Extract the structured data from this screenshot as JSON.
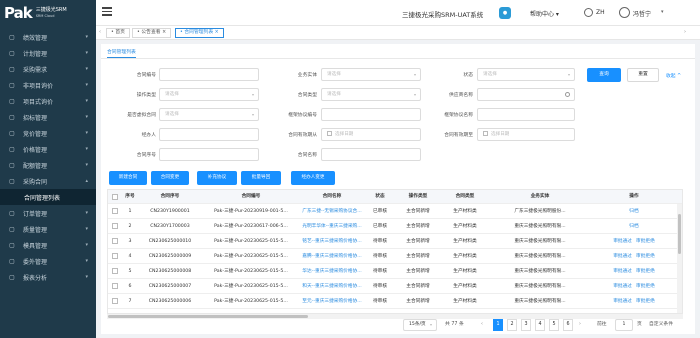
{
  "brand": {
    "logo": "Pak",
    "title": "三捷极光SRM",
    "subtitle": "SRM Cloud"
  },
  "sidebar": {
    "items": [
      {
        "label": "绩效管理",
        "icon": "chart-icon"
      },
      {
        "label": "计划管理",
        "icon": "calendar-icon"
      },
      {
        "label": "采购需求",
        "icon": "cart-icon"
      },
      {
        "label": "非项目询价",
        "icon": "doc-icon"
      },
      {
        "label": "项目式询价",
        "icon": "folder-icon"
      },
      {
        "label": "招标管理",
        "icon": "gavel-icon"
      },
      {
        "label": "竞价管理",
        "icon": "hammer-icon"
      },
      {
        "label": "价格管理",
        "icon": "tag-icon"
      },
      {
        "label": "配额管理",
        "icon": "pie-icon"
      },
      {
        "label": "采购合同",
        "icon": "contract-icon",
        "expanded": true
      }
    ],
    "submenu": "合同管理列表",
    "items_after": [
      {
        "label": "订单管理",
        "icon": "order-icon"
      },
      {
        "label": "质量管理",
        "icon": "quality-icon"
      },
      {
        "label": "模具管理",
        "icon": "mold-icon"
      },
      {
        "label": "委外管理",
        "icon": "outsource-icon"
      },
      {
        "label": "报表分析",
        "icon": "report-icon"
      }
    ]
  },
  "header": {
    "title": "三捷极光采购SRM-UAT系统",
    "help": "帮助中心",
    "lang": "ZH",
    "user": "冯哲宁"
  },
  "tabs": [
    "首页",
    "公告查看",
    "合同管理列表"
  ],
  "subtab": "合同管理列表",
  "filters": {
    "col1": [
      "合同编号",
      "操作类型",
      "是否虚拟合同",
      "经办人",
      "合同序号"
    ],
    "col2": [
      "业务实体",
      "合同类型",
      "框架协议编号",
      "合同有效期从",
      "合同名称"
    ],
    "col3": [
      "状态",
      "供应商名称",
      "框架协议名称",
      "合同有效期至"
    ],
    "select_ph": "请选择",
    "date_ph": "选择日期"
  },
  "buttons": {
    "search": "查询",
    "reset": "重置",
    "collapse": "收起 ^"
  },
  "actions": [
    "新建合同",
    "合同变更",
    "补充协议",
    "批量导回",
    "经办人变更"
  ],
  "grid": {
    "headers": [
      "",
      "序号",
      "合同序号",
      "合同编号",
      "合同名称",
      "状态",
      "操作类型",
      "合同类型",
      "业务实体",
      "操作"
    ],
    "rows": [
      {
        "no": "1",
        "seq": "CN230Y1900001",
        "code": "Pak-三捷-Pur-20230919-001-5...",
        "name": "广东三捷--无锡采购协议合...",
        "status": "已审核",
        "op": "主合同新增",
        "type": "生产材料类",
        "entity": "广东三捷极光照明股份...",
        "actions": [
          "归档"
        ]
      },
      {
        "no": "2",
        "seq": "CN230Y1700003",
        "code": "Pak-三捷-Pur-20230617-006-5...",
        "name": "光明丰华体--重庆三捷采购...",
        "status": "已审核",
        "op": "主合同新增",
        "type": "生产材料类",
        "entity": "重庆三捷极光照明有限...",
        "actions": [
          "归档"
        ]
      },
      {
        "no": "3",
        "seq": "CN230625000010",
        "code": "Pak-三捷-Pur-20230625-015-5...",
        "name": "铭艺--重庆三捷采购价格协...",
        "status": "待审核",
        "op": "主合同新增",
        "type": "生产材料类",
        "entity": "重庆三捷极光照明有限...",
        "actions": [
          "审批通过",
          "审批拒绝"
        ]
      },
      {
        "no": "4",
        "seq": "CN230625000009",
        "code": "Pak-三捷-Pur-20230625-015-5...",
        "name": "嘉腾--重庆三捷采购价格协...",
        "status": "待审核",
        "op": "主合同新增",
        "type": "生产材料类",
        "entity": "重庆三捷极光照明有限...",
        "actions": [
          "审批通过",
          "审批拒绝"
        ]
      },
      {
        "no": "5",
        "seq": "CN230625000008",
        "code": "Pak-三捷-Pur-20230625-015-5...",
        "name": "华达--重庆三捷采购价格协...",
        "status": "待审核",
        "op": "主合同新增",
        "type": "生产材料类",
        "entity": "重庆三捷极光照明有限...",
        "actions": [
          "审批通过",
          "审批拒绝"
        ]
      },
      {
        "no": "6",
        "seq": "CN230625000007",
        "code": "Pak-三捷-Pur-20230625-015-5...",
        "name": "和天--重庆三捷采购价格协...",
        "status": "待审核",
        "op": "主合同新增",
        "type": "生产材料类",
        "entity": "重庆三捷极光照明有限...",
        "actions": [
          "审批通过",
          "审批拒绝"
        ]
      },
      {
        "no": "7",
        "seq": "CN230625000006",
        "code": "Pak-三捷-Pur-20230625-015-5...",
        "name": "至元--重庆三捷采购价格协...",
        "status": "待审核",
        "op": "主合同新增",
        "type": "生产材料类",
        "entity": "重庆三捷极光照明有限...",
        "actions": [
          "审批通过",
          "审批拒绝"
        ]
      }
    ]
  },
  "pagination": {
    "size": "15条/页",
    "total": "共 77 条",
    "pages": [
      "1",
      "2",
      "3",
      "4",
      "5",
      "6"
    ],
    "goto": "前往",
    "page_input": "1",
    "unit": "页",
    "custom": "自定义条件"
  }
}
